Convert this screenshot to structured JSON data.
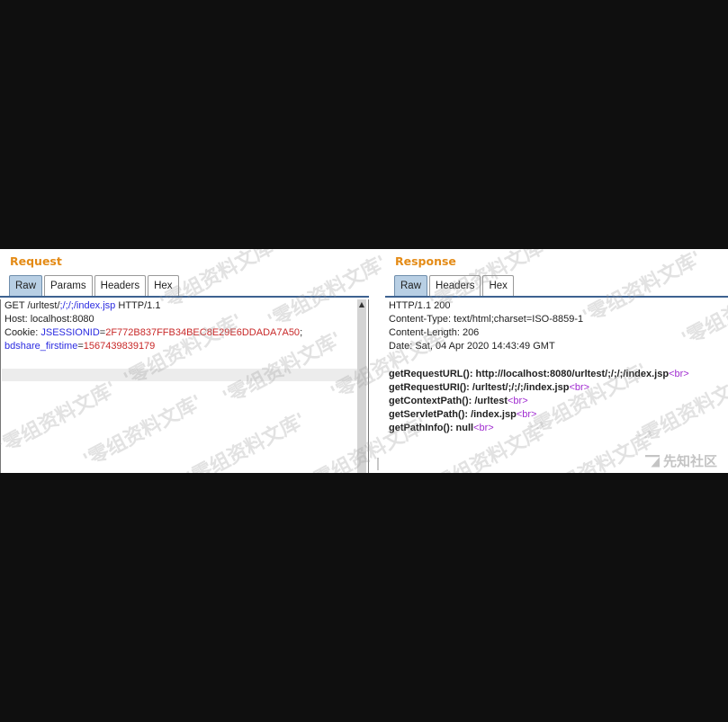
{
  "request": {
    "title": "Request",
    "tabs": [
      "Raw",
      "Params",
      "Headers",
      "Hex"
    ],
    "active_tab": "Raw",
    "lines": {
      "l1_method": "GET /urltest/",
      "l1_path": ";/;/;/index.jsp",
      "l1_proto": " HTTP/1.1",
      "l2": "Host: localhost:8080",
      "l3_key": "Cookie: ",
      "l3_name": "JSESSIONID",
      "l3_eq": "=",
      "l3_value": "2F772B837FFB34BEC8E29E6DDADA7A50",
      "l3_sep": ";",
      "l4_name": "bdshare_firstime",
      "l4_eq": "=",
      "l4_value": "1567439839179"
    }
  },
  "response": {
    "title": "Response",
    "tabs": [
      "Raw",
      "Headers",
      "Hex"
    ],
    "active_tab": "Raw",
    "lines": {
      "l1": "HTTP/1.1 200",
      "l2": "Content-Type: text/html;charset=ISO-8859-1",
      "l3": "Content-Length: 206",
      "l4": "Date: Sat, 04 Apr 2020 14:43:49 GMT",
      "b1": "getRequestURL(): http://localhost:8080/urltest/;/;/;/index.jsp",
      "b2": "getRequestURI(): /urltest/;/;/;/index.jsp",
      "b3": "getContextPath(): /urltest",
      "b4": "getServletPath(): /index.jsp",
      "b5": "getPathInfo(): null",
      "br": "<br>"
    }
  },
  "watermark": "'零组资料文库'",
  "logo": "先知社区"
}
